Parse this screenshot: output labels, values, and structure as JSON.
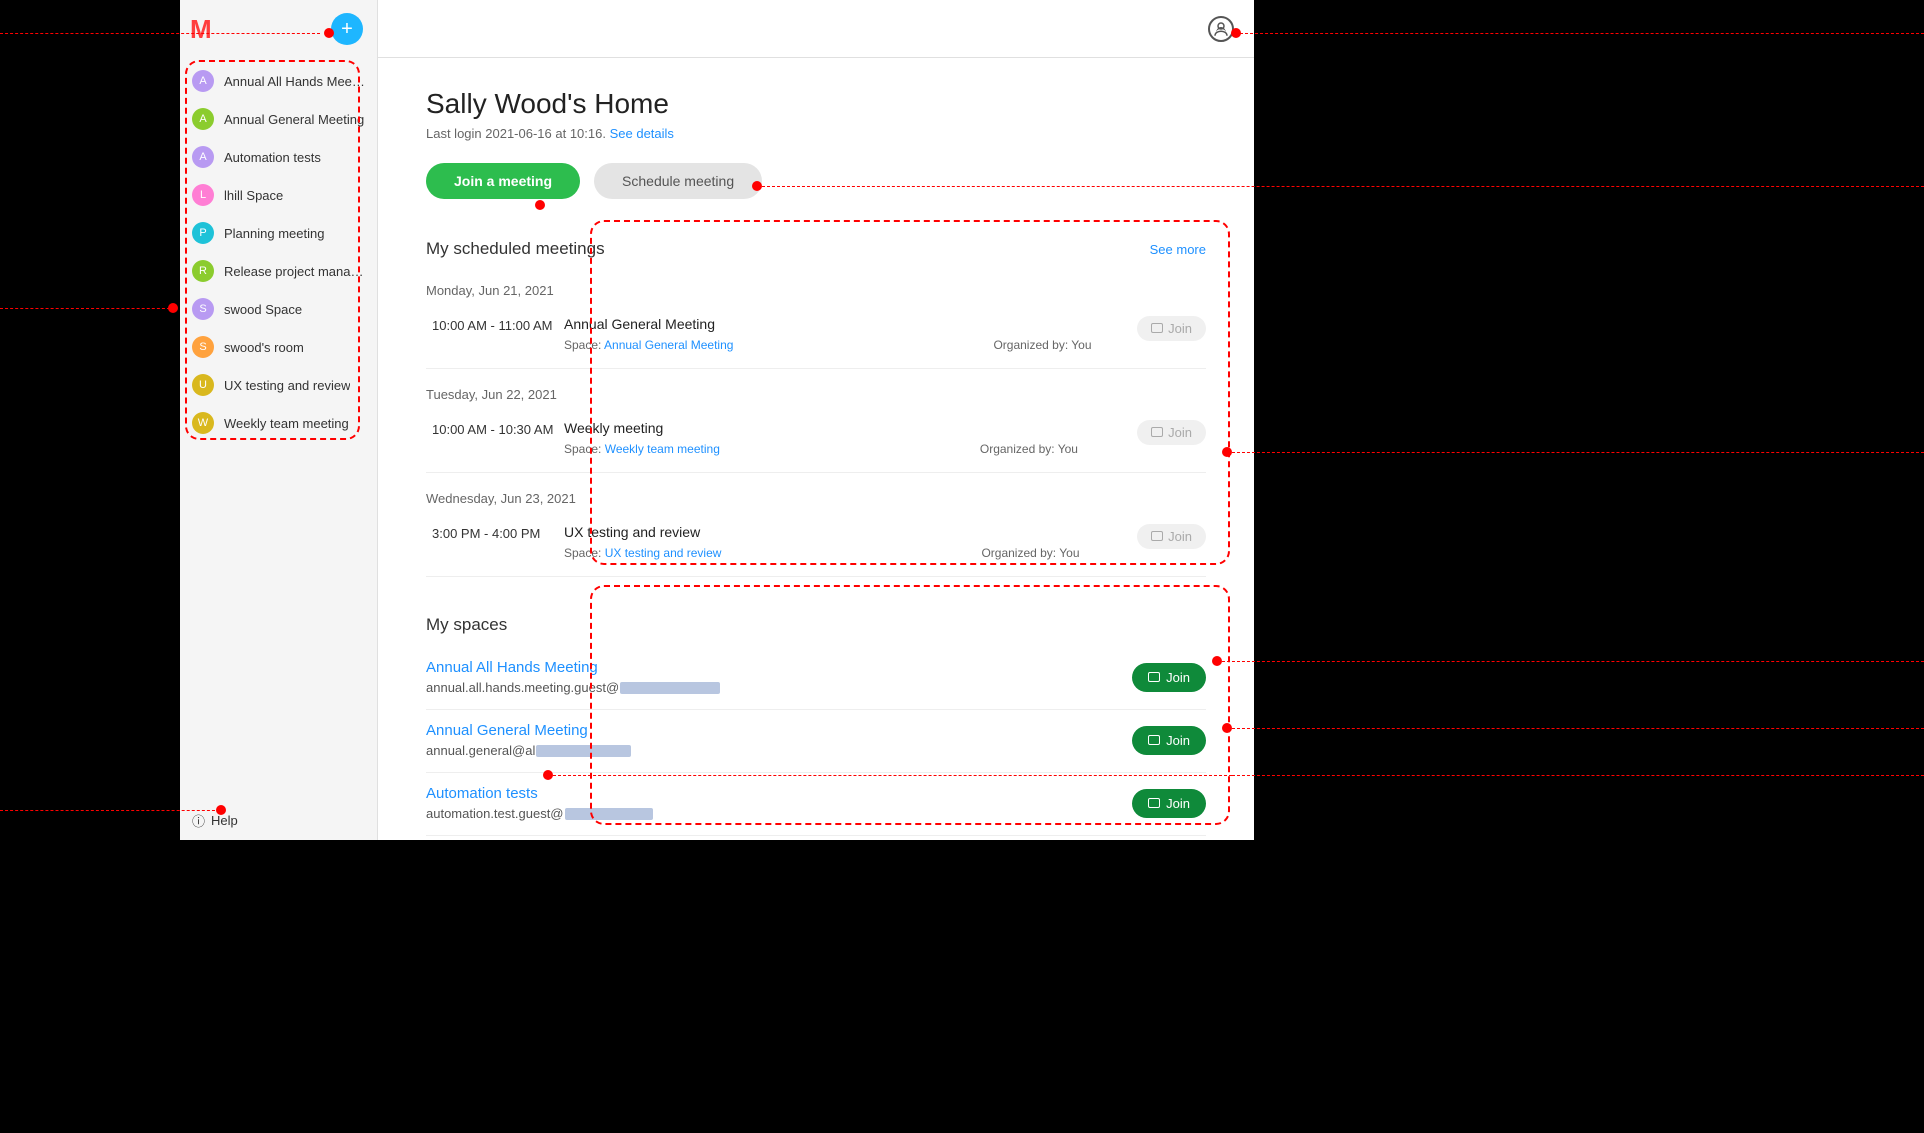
{
  "sidebar": {
    "spaces": [
      {
        "letter": "A",
        "label": "Annual All Hands Meeting",
        "color": "#b89af2"
      },
      {
        "letter": "A",
        "label": "Annual General Meeting",
        "color": "#8bcc2e"
      },
      {
        "letter": "A",
        "label": "Automation tests",
        "color": "#b89af2"
      },
      {
        "letter": "L",
        "label": "lhill Space",
        "color": "#ff7ed4"
      },
      {
        "letter": "P",
        "label": "Planning meeting",
        "color": "#1ec2d8"
      },
      {
        "letter": "R",
        "label": "Release project manage…",
        "color": "#8bcc2e"
      },
      {
        "letter": "S",
        "label": "swood Space",
        "color": "#b89af2"
      },
      {
        "letter": "S",
        "label": "swood's room",
        "color": "#ffa23e"
      },
      {
        "letter": "U",
        "label": "UX testing and review",
        "color": "#d9b81e"
      },
      {
        "letter": "W",
        "label": "Weekly team meeting",
        "color": "#d9b81e"
      }
    ],
    "help": "Help"
  },
  "header": {
    "title": "Sally Wood's Home",
    "last_login": "Last login 2021-06-16 at 10:16.",
    "see_details": "See details"
  },
  "actions": {
    "join": "Join a meeting",
    "schedule": "Schedule meeting"
  },
  "scheduled": {
    "title": "My scheduled meetings",
    "see_more": "See more",
    "space_prefix": "Space:",
    "org_prefix": "Organized by:",
    "join_label": "Join",
    "days": [
      {
        "day": "Monday, Jun 21, 2021",
        "meetings": [
          {
            "time": "10:00 AM - 11:00 AM",
            "title": "Annual General Meeting",
            "space": "Annual General Meeting",
            "org": "You"
          }
        ]
      },
      {
        "day": "Tuesday, Jun 22, 2021",
        "meetings": [
          {
            "time": "10:00 AM - 10:30 AM",
            "title": "Weekly meeting",
            "space": "Weekly team meeting",
            "org": "You"
          }
        ]
      },
      {
        "day": "Wednesday, Jun 23, 2021",
        "meetings": [
          {
            "time": "3:00 PM - 4:00 PM",
            "title": "UX testing and review",
            "space": "UX testing and review",
            "org": "You"
          }
        ]
      }
    ]
  },
  "myspaces": {
    "title": "My spaces",
    "join_label": "Join",
    "items": [
      {
        "name": "Annual All Hands Meeting",
        "addr": "annual.all.hands.meeting.guest@",
        "redact_w": 100
      },
      {
        "name": "Annual General Meeting",
        "addr": "annual.general@al",
        "redact_w": 95
      },
      {
        "name": "Automation tests",
        "addr": "automation.test.guest@",
        "redact_w": 88
      }
    ]
  }
}
